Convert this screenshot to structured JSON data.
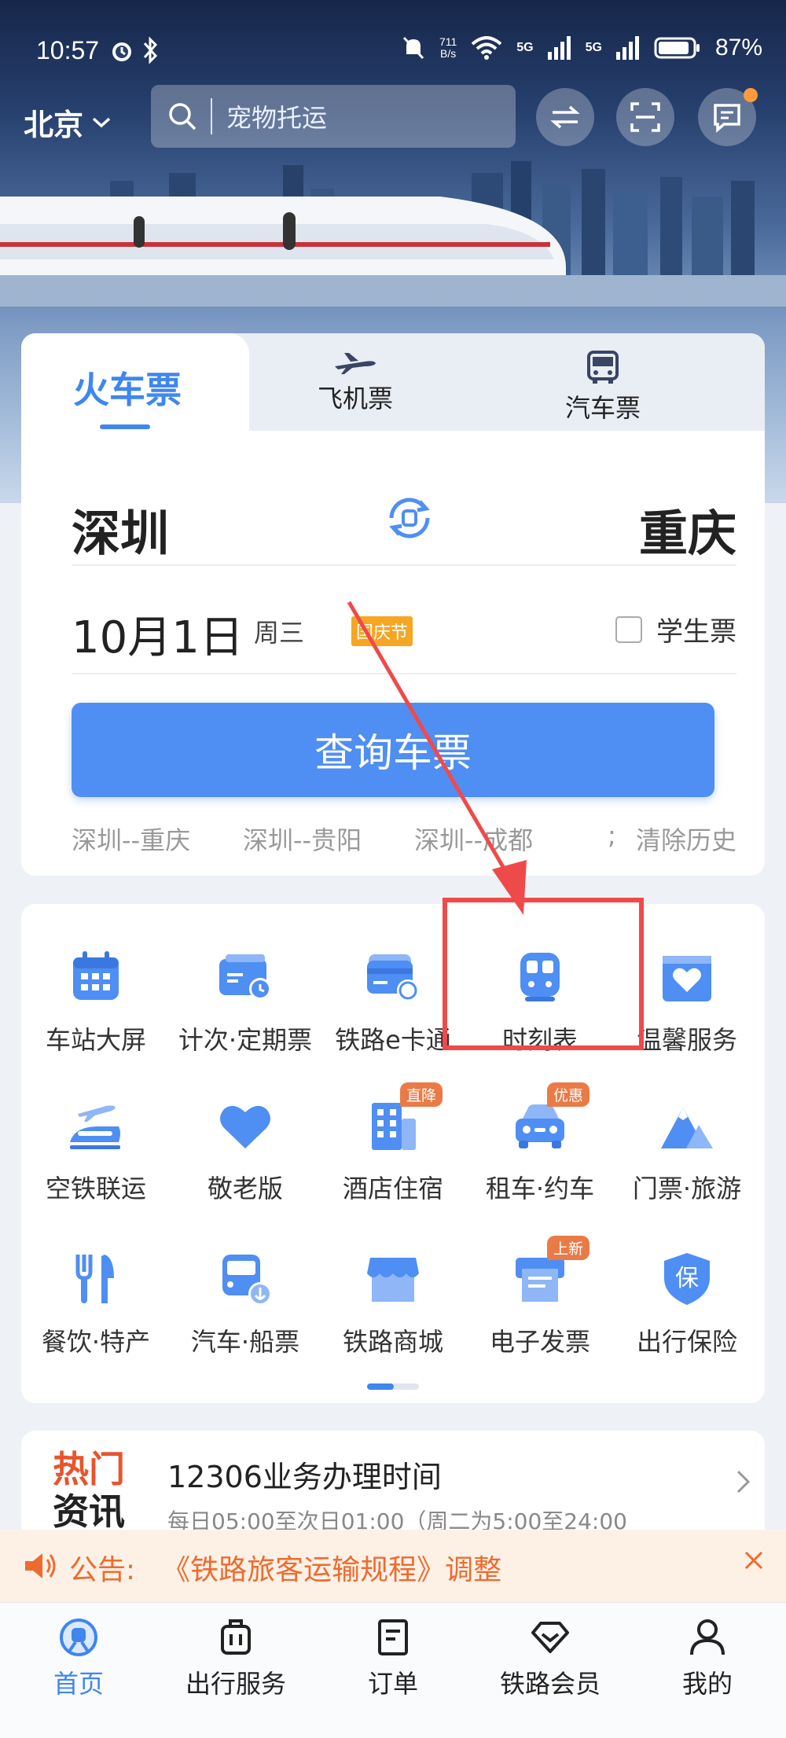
{
  "status_bar": {
    "time": "10:57",
    "net_speed_top": "711",
    "net_speed_unit": "B/s",
    "signal_1": "5G",
    "signal_2": "5G",
    "battery": "87%"
  },
  "header": {
    "city": "北京",
    "search_placeholder": "宠物托运"
  },
  "ticket_tabs": [
    {
      "label": "火车票",
      "icon": "train"
    },
    {
      "label": "飞机票",
      "icon": "plane-icon"
    },
    {
      "label": "汽车票",
      "icon": "bus-icon"
    }
  ],
  "booking": {
    "from_city": "深圳",
    "to_city": "重庆",
    "date": "10月1日",
    "weekday": "周三",
    "holiday_tag": "国庆节",
    "student_ticket_label": "学生票",
    "query_button": "查询车票",
    "history": [
      "深圳--重庆",
      "深圳--贵阳",
      "深圳--成都"
    ],
    "history_more": "; ",
    "clear_history": "清除历史"
  },
  "services": [
    {
      "label": "车站大屏",
      "icon": "calendar-icon"
    },
    {
      "label": "计次·定期票",
      "icon": "ticket-clock-icon"
    },
    {
      "label": "铁路e卡通",
      "icon": "rail-card-icon"
    },
    {
      "label": "时刻表",
      "icon": "timetable-train-icon"
    },
    {
      "label": "温馨服务",
      "icon": "heart-box-icon"
    },
    {
      "label": "空铁联运",
      "icon": "plane-train-icon"
    },
    {
      "label": "敬老版",
      "icon": "heart-icon"
    },
    {
      "label": "酒店住宿",
      "icon": "building-icon",
      "badge": "直降"
    },
    {
      "label": "租车·约车",
      "icon": "car-icon",
      "badge": "优惠"
    },
    {
      "label": "门票·旅游",
      "icon": "mountain-icon"
    },
    {
      "label": "餐饮·特产",
      "icon": "fork-knife-icon"
    },
    {
      "label": "汽车·船票",
      "icon": "bus-anchor-icon"
    },
    {
      "label": "铁路商城",
      "icon": "shop-icon"
    },
    {
      "label": "电子发票",
      "icon": "invoice-icon",
      "badge": "上新"
    },
    {
      "label": "出行保险",
      "icon": "shield-icon"
    }
  ],
  "news": {
    "tag_line1_hot": "热门",
    "tag_line2": "资讯",
    "title": "12306业务办理时间",
    "subtitle": "每日05:00至次日01:00（周二为5:00至24:00"
  },
  "notice": {
    "prefix": "公告:",
    "text": "《铁路旅客运输规程》调整"
  },
  "tab_bar": [
    {
      "label": "首页",
      "active": true
    },
    {
      "label": "出行服务"
    },
    {
      "label": "订单"
    },
    {
      "label": "铁路会员"
    },
    {
      "label": "我的"
    }
  ],
  "colors": {
    "primary": "#4f8ef3",
    "accent_orange": "#ee6b2f",
    "annotation_red": "#ef4a4a"
  }
}
